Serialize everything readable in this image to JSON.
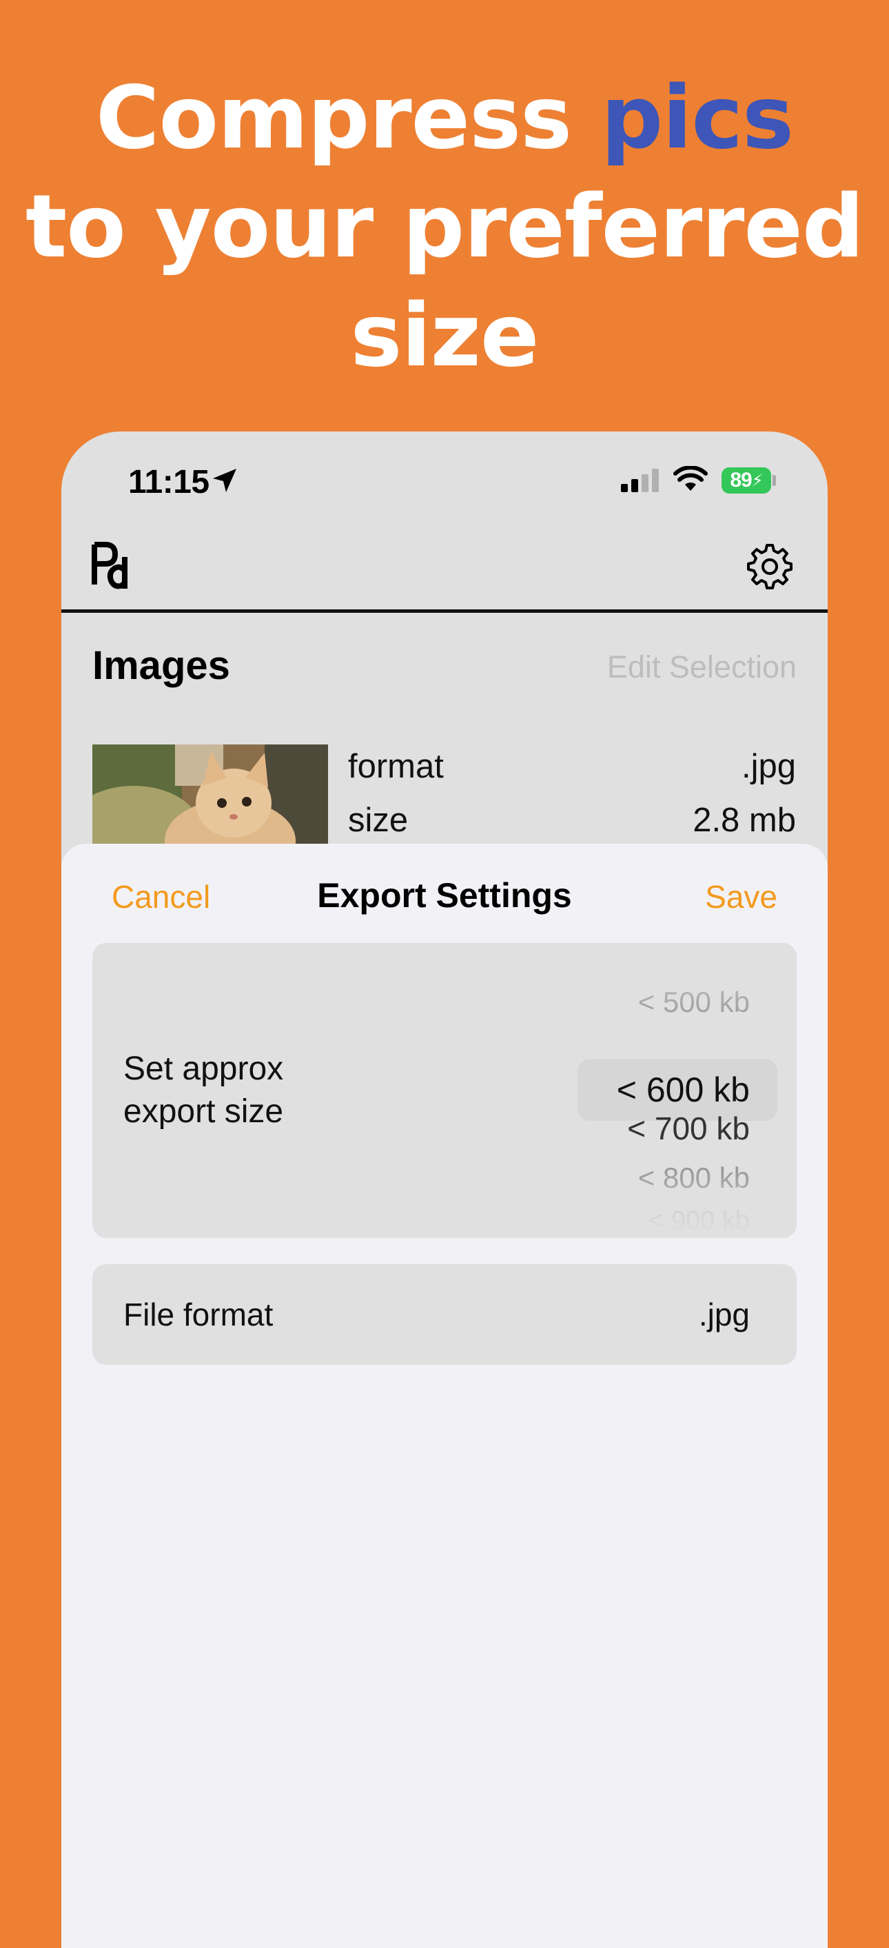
{
  "headline": {
    "line1_prefix": "Compress ",
    "line1_accent": "pics",
    "line2": "to your preferred",
    "line3": "size"
  },
  "colors": {
    "background": "#EE8033",
    "accent_word": "#3D56B8",
    "action_orange": "#F39A1E",
    "battery_green": "#34C759"
  },
  "status_bar": {
    "time": "11:15",
    "battery": "89"
  },
  "top_bar": {
    "logo_icon": "app-logo",
    "settings_icon": "gear-icon"
  },
  "images_section": {
    "title": "Images",
    "edit_selection": "Edit Selection",
    "item": {
      "format_label": "format",
      "format_value": ".jpg",
      "size_label": "size",
      "size_value": "2.8 mb"
    }
  },
  "export_sheet": {
    "cancel": "Cancel",
    "title": "Export Settings",
    "save": "Save",
    "size_setting": {
      "label_line1": "Set approx",
      "label_line2": "export size",
      "options": [
        "< 500 kb",
        "< 600 kb",
        "< 700 kb",
        "< 800 kb",
        "< 900 kb"
      ],
      "selected": "< 600 kb"
    },
    "file_format": {
      "label": "File format",
      "value": ".jpg"
    }
  }
}
